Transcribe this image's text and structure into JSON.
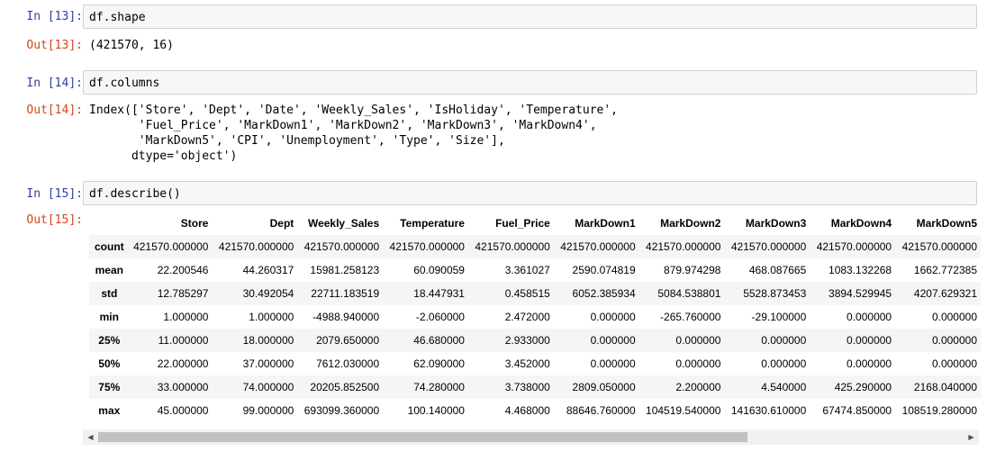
{
  "cells": [
    {
      "in_prompt": "In [13]:",
      "code": "df.shape",
      "out_prompt": "Out[13]:",
      "output": "(421570, 16)"
    },
    {
      "in_prompt": "In [14]:",
      "code": "df.columns",
      "out_prompt": "Out[14]:",
      "output": "Index(['Store', 'Dept', 'Date', 'Weekly_Sales', 'IsHoliday', 'Temperature',\n       'Fuel_Price', 'MarkDown1', 'MarkDown2', 'MarkDown3', 'MarkDown4',\n       'MarkDown5', 'CPI', 'Unemployment', 'Type', 'Size'],\n      dtype='object')"
    },
    {
      "in_prompt": "In [15]:",
      "code": "df.describe()",
      "out_prompt": "Out[15]:"
    }
  ],
  "describe_table": {
    "columns": [
      "Store",
      "Dept",
      "Weekly_Sales",
      "Temperature",
      "Fuel_Price",
      "MarkDown1",
      "MarkDown2",
      "MarkDown3",
      "MarkDown4",
      "MarkDown5"
    ],
    "rows": [
      {
        "label": "count",
        "values": [
          "421570.000000",
          "421570.000000",
          "421570.000000",
          "421570.000000",
          "421570.000000",
          "421570.000000",
          "421570.000000",
          "421570.000000",
          "421570.000000",
          "421570.000000"
        ]
      },
      {
        "label": "mean",
        "values": [
          "22.200546",
          "44.260317",
          "15981.258123",
          "60.090059",
          "3.361027",
          "2590.074819",
          "879.974298",
          "468.087665",
          "1083.132268",
          "1662.772385"
        ]
      },
      {
        "label": "std",
        "values": [
          "12.785297",
          "30.492054",
          "22711.183519",
          "18.447931",
          "0.458515",
          "6052.385934",
          "5084.538801",
          "5528.873453",
          "3894.529945",
          "4207.629321"
        ]
      },
      {
        "label": "min",
        "values": [
          "1.000000",
          "1.000000",
          "-4988.940000",
          "-2.060000",
          "2.472000",
          "0.000000",
          "-265.760000",
          "-29.100000",
          "0.000000",
          "0.000000"
        ]
      },
      {
        "label": "25%",
        "values": [
          "11.000000",
          "18.000000",
          "2079.650000",
          "46.680000",
          "2.933000",
          "0.000000",
          "0.000000",
          "0.000000",
          "0.000000",
          "0.000000"
        ]
      },
      {
        "label": "50%",
        "values": [
          "22.000000",
          "37.000000",
          "7612.030000",
          "62.090000",
          "3.452000",
          "0.000000",
          "0.000000",
          "0.000000",
          "0.000000",
          "0.000000"
        ]
      },
      {
        "label": "75%",
        "values": [
          "33.000000",
          "74.000000",
          "20205.852500",
          "74.280000",
          "3.738000",
          "2809.050000",
          "2.200000",
          "4.540000",
          "425.290000",
          "2168.040000"
        ]
      },
      {
        "label": "max",
        "values": [
          "45.000000",
          "99.000000",
          "693099.360000",
          "100.140000",
          "4.468000",
          "88646.760000",
          "104519.540000",
          "141630.610000",
          "67474.850000",
          "108519.280000"
        ]
      }
    ]
  },
  "scrollbar": {
    "left_arrow": "◀",
    "right_arrow": "▶",
    "visible_fraction": 0.75
  }
}
